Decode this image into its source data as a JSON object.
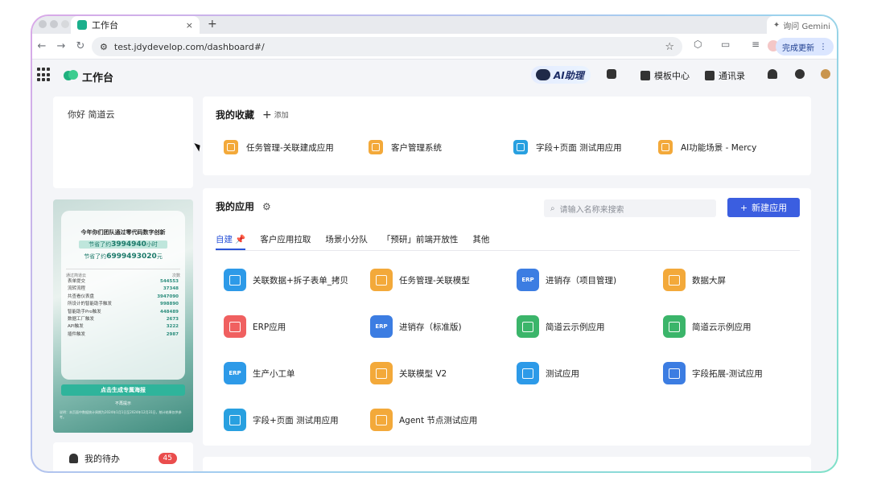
{
  "browser": {
    "tab_title": "工作台",
    "tab_close": "×",
    "new_tab": "+",
    "gemini_label": "询问 Gemini",
    "url": "test.jdydevelop.com/dashboard#/",
    "update_button": "完成更新"
  },
  "header": {
    "title": "工作台",
    "ai_assistant": "AI助理",
    "template_center": "模板中心",
    "contacts": "通讯录"
  },
  "sidebar": {
    "greeting": "你好 简道云",
    "poster": {
      "headline": "今年你们团队通过零代码数字创新",
      "saved_hours_prefix": "节省了约",
      "saved_hours_value": "3994940",
      "saved_hours_unit": "小时",
      "saved_money_prefix": "节省了约",
      "saved_money_value": "6999493020",
      "saved_money_unit": "元",
      "sub_left": "通过简道云",
      "sub_right": "次数",
      "stats": [
        {
          "label": "表单提交",
          "value": "544553"
        },
        {
          "label": "流转流程",
          "value": "37348"
        },
        {
          "label": "共查看仪表盘",
          "value": "3947090"
        },
        {
          "label": "所设计的智能助手触发",
          "value": "998890"
        },
        {
          "label": "智能助手Pro触发",
          "value": "448489"
        },
        {
          "label": "数据工厂触发",
          "value": "2673"
        },
        {
          "label": "API触发",
          "value": "3222"
        },
        {
          "label": "插件触发",
          "value": "2987"
        }
      ],
      "cta": "点击生成专属海报",
      "hide": "不再提示",
      "footnote": "说明：本页面中数据统计周期为2024年1月1日至2024年12月31日，统计结果仅供参考。"
    },
    "todo": {
      "label": "我的待办",
      "count": "45"
    }
  },
  "favorites": {
    "title": "我的收藏",
    "add_label": "添加",
    "items": [
      {
        "label": "任务管理-关联建成应用",
        "color": "#f3a93a"
      },
      {
        "label": "客户管理系统",
        "color": "#f3a93a"
      },
      {
        "label": "字段+页面 测试用应用",
        "color": "#28a0e0"
      },
      {
        "label": "AI功能场景 - Mercy",
        "color": "#f3a93a"
      }
    ]
  },
  "apps": {
    "title": "我的应用",
    "search_placeholder": "请输入名称来搜索",
    "new_button": "新建应用",
    "tabs": [
      "自建",
      "客户应用拉取",
      "场景小分队",
      "「预研」前端开放性",
      "其他"
    ],
    "items": [
      {
        "label": "关联数据+拆子表单_拷贝",
        "icon": "ic-blue",
        "tag": ""
      },
      {
        "label": "任务管理-关联模型",
        "icon": "ic-orange",
        "tag": ""
      },
      {
        "label": "进销存（项目管理)",
        "icon": "ic-navy",
        "tag": "ERP"
      },
      {
        "label": "数据大屏",
        "icon": "ic-orange",
        "tag": ""
      },
      {
        "label": "ERP应用",
        "icon": "ic-red",
        "tag": ""
      },
      {
        "label": "进销存（标准版)",
        "icon": "ic-navy",
        "tag": "ERP"
      },
      {
        "label": "简道云示例应用",
        "icon": "ic-green",
        "tag": ""
      },
      {
        "label": "简道云示例应用",
        "icon": "ic-green",
        "tag": ""
      },
      {
        "label": "生产小工单",
        "icon": "ic-blue",
        "tag": "ERP"
      },
      {
        "label": "关联模型 V2",
        "icon": "ic-orange",
        "tag": ""
      },
      {
        "label": "测试应用",
        "icon": "ic-blue",
        "tag": ""
      },
      {
        "label": "字段拓展-测试应用",
        "icon": "ic-navy",
        "tag": ""
      },
      {
        "label": "字段+页面 测试用应用",
        "icon": "ic-puzzle",
        "tag": ""
      },
      {
        "label": "Agent 节点测试应用",
        "icon": "ic-orange",
        "tag": ""
      }
    ]
  }
}
